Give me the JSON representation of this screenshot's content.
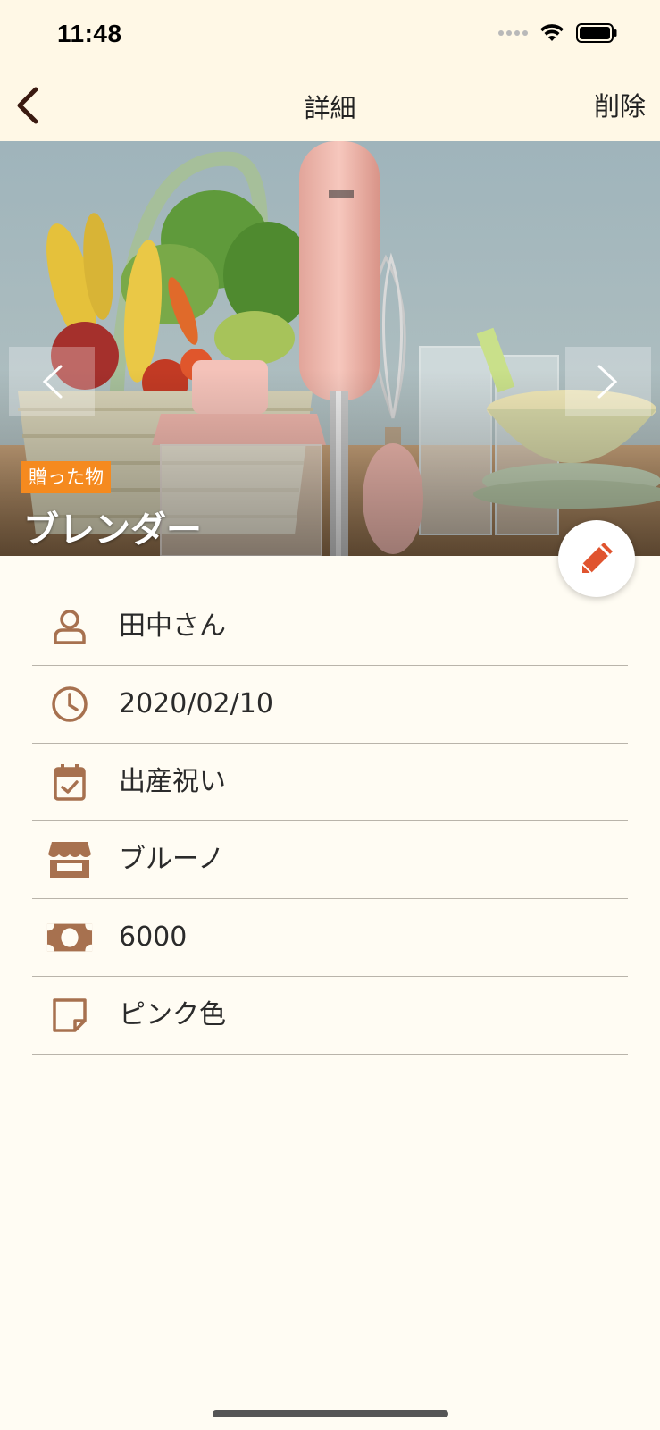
{
  "status_bar": {
    "time": "11:48"
  },
  "nav": {
    "title": "詳細",
    "delete_label": "削除"
  },
  "hero": {
    "category_badge": "贈った物",
    "item_name": "ブレンダー"
  },
  "details": [
    {
      "icon": "person-icon",
      "value": "田中さん"
    },
    {
      "icon": "clock-icon",
      "value": "2020/02/10"
    },
    {
      "icon": "calendar-check-icon",
      "value": "出産祝い"
    },
    {
      "icon": "store-icon",
      "value": "ブルーノ"
    },
    {
      "icon": "money-icon",
      "value": "6000"
    },
    {
      "icon": "sticky-note-icon",
      "value": "ピンク色"
    }
  ],
  "colors": {
    "accent_orange": "#f58a1f",
    "icon_brown": "#a7714f",
    "edit_red": "#e0542f",
    "background": "#fffcf3",
    "bar_background": "#fff8e6"
  }
}
